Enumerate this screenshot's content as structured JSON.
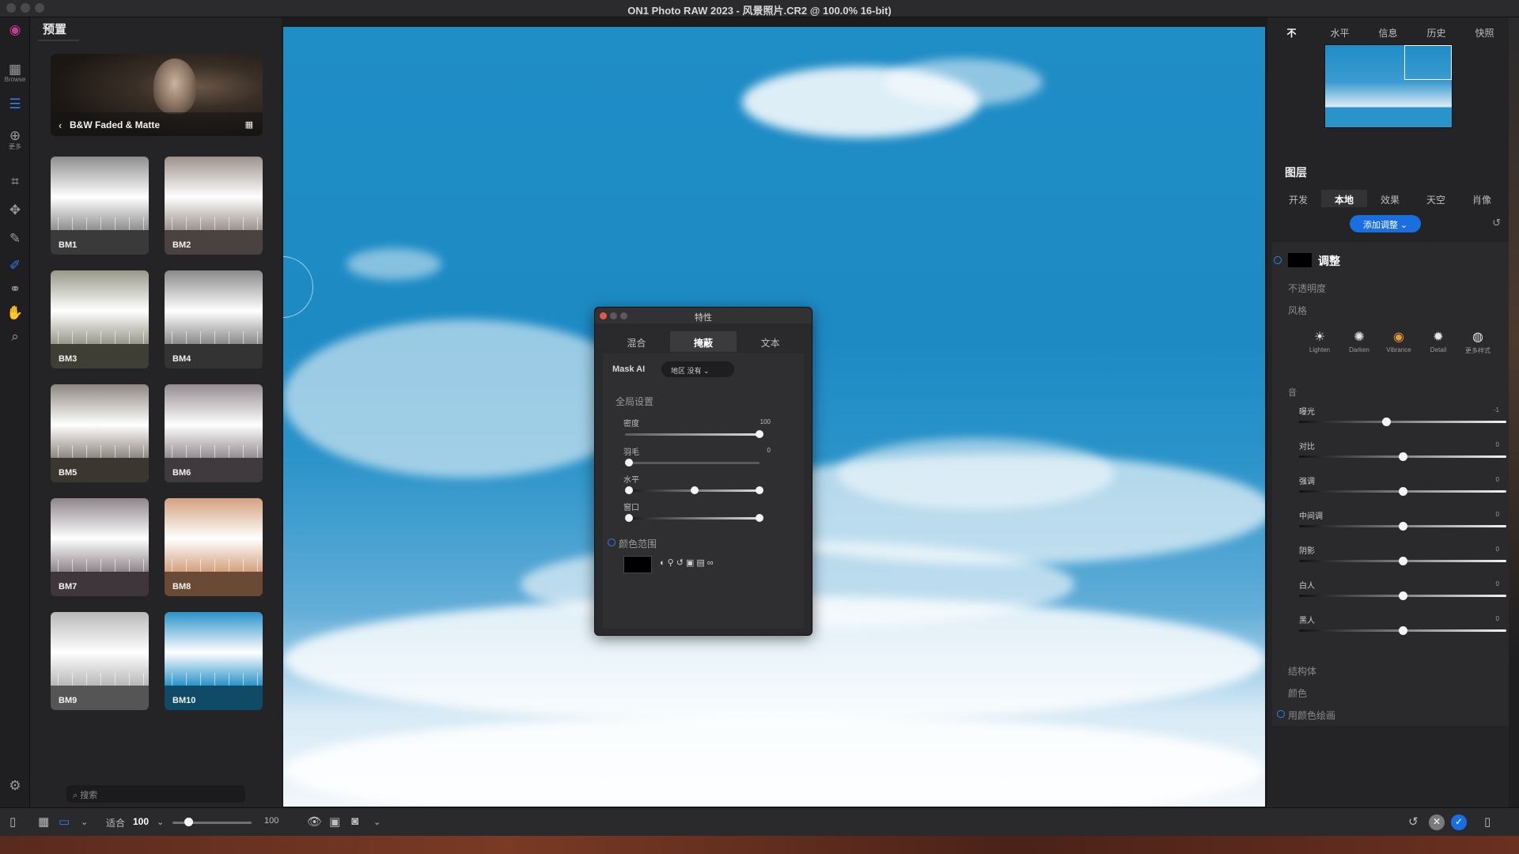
{
  "window": {
    "title": "ON1 Photo RAW 2023 - 风景照片.CR2 @ 100.0% 16-bit)"
  },
  "toolrail": {
    "browse_label": "Browse",
    "more_label": "更多"
  },
  "presets": {
    "heading": "预置",
    "category": "B&W Faded & Matte",
    "items": [
      {
        "label": "BM1",
        "sky": "#8e8e8e",
        "ground": "#3a3a3a"
      },
      {
        "label": "BM2",
        "sky": "#9c928d",
        "ground": "#4a4240"
      },
      {
        "label": "BM3",
        "sky": "#98988a",
        "ground": "#3e3e34"
      },
      {
        "label": "BM4",
        "sky": "#8a8a8a",
        "ground": "#333333"
      },
      {
        "label": "BM5",
        "sky": "#8e8780",
        "ground": "#3c3630"
      },
      {
        "label": "BM6",
        "sky": "#958c90",
        "ground": "#403a3e"
      },
      {
        "label": "BM7",
        "sky": "#8e858a",
        "ground": "#3e363a"
      },
      {
        "label": "BM8",
        "sky": "#d3a17f",
        "ground": "#6a4a34"
      },
      {
        "label": "BM9",
        "sky": "#b8b8b8",
        "ground": "#555555"
      },
      {
        "label": "BM10",
        "sky": "#2a93c9",
        "ground": "#0f4a66"
      }
    ],
    "search_placeholder": "搜索"
  },
  "dialog": {
    "title": "特性",
    "tabs": [
      "混合",
      "掩蔽",
      "文本"
    ],
    "active_tab": "掩蔽",
    "mask_ai_label": "Mask AI",
    "mask_ai_dropdown": "地区 没有",
    "global_settings": "全局设置",
    "sliders": [
      {
        "label": "密度",
        "value": "100"
      },
      {
        "label": "羽毛",
        "value": "0"
      },
      {
        "label": "水平",
        "value": ""
      },
      {
        "label": "窗口",
        "value": ""
      }
    ],
    "color_range": "颜色范围"
  },
  "right": {
    "top_tabs": [
      "不",
      "水平",
      "信息",
      "历史",
      "快照"
    ],
    "layers_heading": "图层",
    "layer_tabs": [
      "开发",
      "本地",
      "效果",
      "天空",
      "肖像"
    ],
    "active_layer_tab": "本地",
    "add_adjustment": "添加调整",
    "adjustment_title": "调整",
    "opacity_label": "不透明度",
    "style_label": "风格",
    "styles": [
      {
        "icon": "☀",
        "label": "Lighten"
      },
      {
        "icon": "✺",
        "label": "Darken"
      },
      {
        "icon": "◉",
        "label": "Vibrance"
      },
      {
        "icon": "✹",
        "label": "Detail"
      },
      {
        "icon": "◍",
        "label": "更多样式"
      }
    ],
    "tone_label": "音",
    "tone_sliders": [
      {
        "label": "曝光",
        "value": "-1",
        "level": 0.42
      },
      {
        "label": "对比",
        "value": "0",
        "level": 0.5
      },
      {
        "label": "强调",
        "value": "0",
        "level": 0.5
      },
      {
        "label": "中间调",
        "value": "0",
        "level": 0.5
      },
      {
        "label": "阴影",
        "value": "0",
        "level": 0.5
      },
      {
        "label": "白人",
        "value": "0",
        "level": 0.5
      },
      {
        "label": "黑人",
        "value": "0",
        "level": 0.5
      }
    ],
    "structure_label": "结构体",
    "color_label": "颜色",
    "paint_with_color": "用颜色绘画"
  },
  "bottombar": {
    "fit_label": "适合",
    "zoom_value": "100",
    "zoom_slider_value": "100"
  }
}
